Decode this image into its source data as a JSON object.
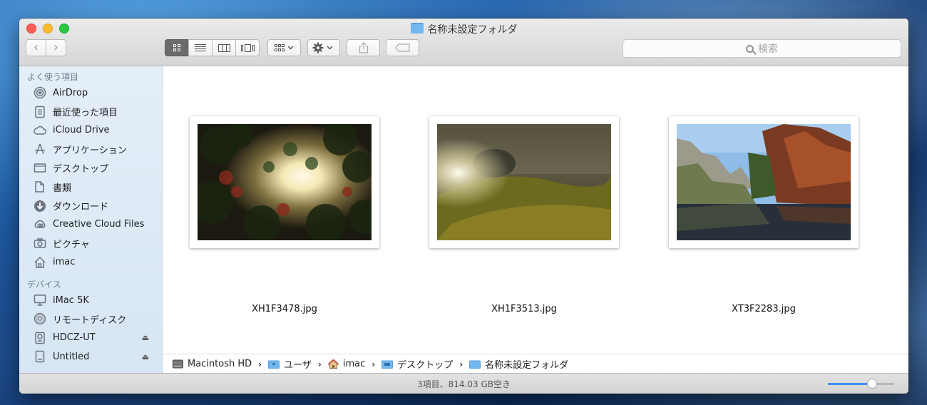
{
  "window": {
    "title": "名称未設定フォルダ"
  },
  "toolbar": {
    "search_placeholder": "検索"
  },
  "sidebar": {
    "favorites_header": "よく使う項目",
    "favorites": [
      {
        "label": "AirDrop",
        "icon": "airdrop-icon"
      },
      {
        "label": "最近使った項目",
        "icon": "recents-icon"
      },
      {
        "label": "iCloud Drive",
        "icon": "cloud-icon"
      },
      {
        "label": "アプリケーション",
        "icon": "applications-icon"
      },
      {
        "label": "デスクトップ",
        "icon": "desktop-icon"
      },
      {
        "label": "書類",
        "icon": "documents-icon"
      },
      {
        "label": "ダウンロード",
        "icon": "downloads-icon"
      },
      {
        "label": "Creative Cloud Files",
        "icon": "creative-cloud-icon"
      },
      {
        "label": "ピクチャ",
        "icon": "camera-icon"
      },
      {
        "label": "imac",
        "icon": "home-icon"
      }
    ],
    "devices_header": "デバイス",
    "devices": [
      {
        "label": "iMac 5K",
        "icon": "imac-icon"
      },
      {
        "label": "リモートディスク",
        "icon": "remote-disc-icon"
      },
      {
        "label": "HDCZ-UT",
        "icon": "external-drive-icon",
        "eject": true
      },
      {
        "label": "Untitled",
        "icon": "disk-icon",
        "eject": true
      }
    ]
  },
  "files": [
    {
      "name": "XH1F3478.jpg"
    },
    {
      "name": "XH1F3513.jpg"
    },
    {
      "name": "XT3F2283.jpg"
    }
  ],
  "path": [
    "Macintosh HD",
    "ユーザ",
    "imac",
    "デスクトップ",
    "名称未設定フォルダ"
  ],
  "status": {
    "text": "3項目、814.03 GB空き",
    "icon_size_fraction": 0.67
  },
  "colors": {
    "accent": "#3f8ef4",
    "folder": "#72b7ef",
    "sidebar": "#dce9f6"
  }
}
